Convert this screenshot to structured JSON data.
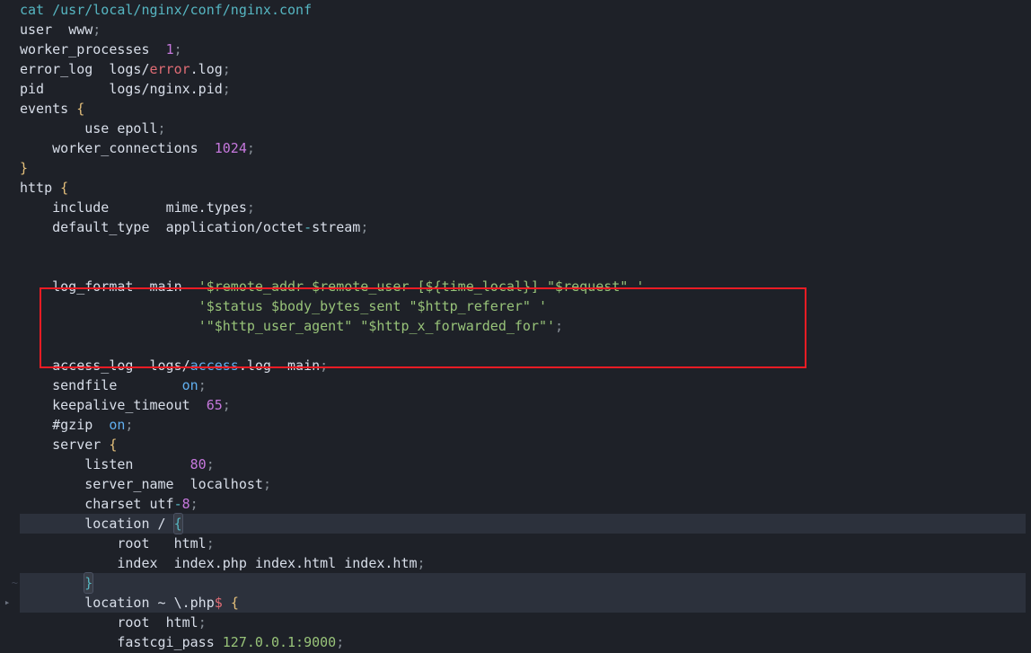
{
  "t": {
    "cmd_cat": "cat",
    "path_conf": "/usr/local/nginx/conf/nginx.conf",
    "user": "user",
    "www": "www",
    "wp": "worker_processes",
    "one": "1",
    "el": "error_log",
    "logs_slash": "logs/",
    "error": "error",
    "dotlog": ".log",
    "pid": "pid",
    "pid_path": "logs/nginx.pid",
    "events": "events",
    "use": "use",
    "epoll": "epoll",
    "wc": "worker_connections",
    "n1024": "1024",
    "http": "http",
    "include": "include",
    "mime": "mime.types",
    "deftype": "default_type",
    "app": "application/octet",
    "stream": "stream",
    "lf": "log_format",
    "main": "main",
    "lf1a": "'$remote_addr $remote_user [${time_local}] \"$request\" '",
    "lf2a": "'$status $body_bytes_sent \"$http_referer\" '",
    "lf3a": "'\"$http_user_agent\" \"$http_x_forwarded_for\"'",
    "al": "access_log",
    "access": "access",
    "mainw": "main",
    "sf": "sendfile",
    "on": "on",
    "kt": "keepalive_timeout",
    "n65": "65",
    "gzip": "#gzip",
    "server": "server",
    "listen": "listen",
    "n80": "80",
    "sname": "server_name",
    "localhost": "localhost",
    "charset": "charset",
    "utf": "utf",
    "eight": "8",
    "location": "location",
    "slash": "/",
    "root": "root",
    "html": "html",
    "index": "index",
    "indexfiles": "index.php index.html index.htm",
    "locphp": "location ~ \\.php",
    "dollar": "$",
    "fcgi": "fastcgi_pass",
    "addr": "127.0.0.1:9000"
  }
}
